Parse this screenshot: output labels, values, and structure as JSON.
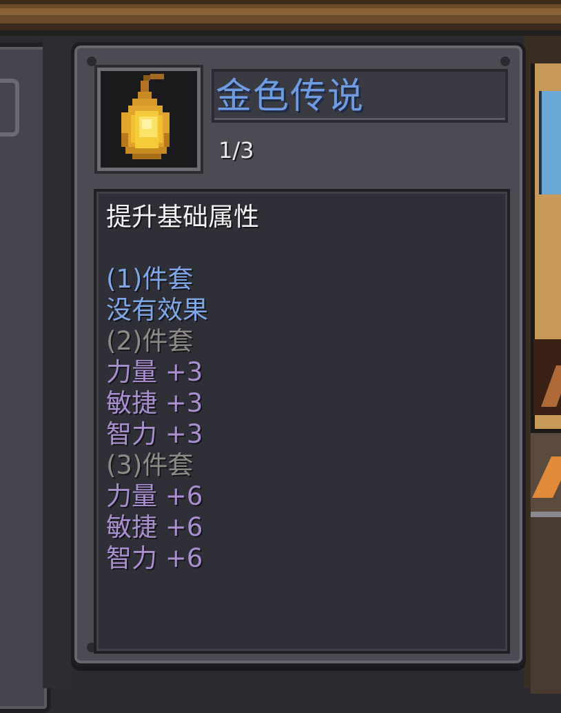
{
  "item": {
    "name": "金色传说",
    "set_progress": "1/3",
    "icon": "golden-gourd-icon"
  },
  "description": {
    "header": "提升基础属性",
    "lines": [
      {
        "text": "(1)件套",
        "style": "active"
      },
      {
        "text": "没有效果",
        "style": "active"
      },
      {
        "text": "(2)件套",
        "style": "inactive"
      },
      {
        "text": "力量 +3",
        "style": "stat"
      },
      {
        "text": "敏捷 +3",
        "style": "stat"
      },
      {
        "text": "智力 +3",
        "style": "stat"
      },
      {
        "text": "(3)件套",
        "style": "inactive"
      },
      {
        "text": "力量 +6",
        "style": "stat"
      },
      {
        "text": "敏捷 +6",
        "style": "stat"
      },
      {
        "text": "智力 +6",
        "style": "stat"
      }
    ]
  },
  "colors": {
    "name": "#6f9be0",
    "active_tier": "#7fa6e6",
    "inactive_tier": "#8e8a86",
    "stat": "#a98ed0",
    "header": "#f2f2f2",
    "icon_gold": "#f0c030"
  }
}
